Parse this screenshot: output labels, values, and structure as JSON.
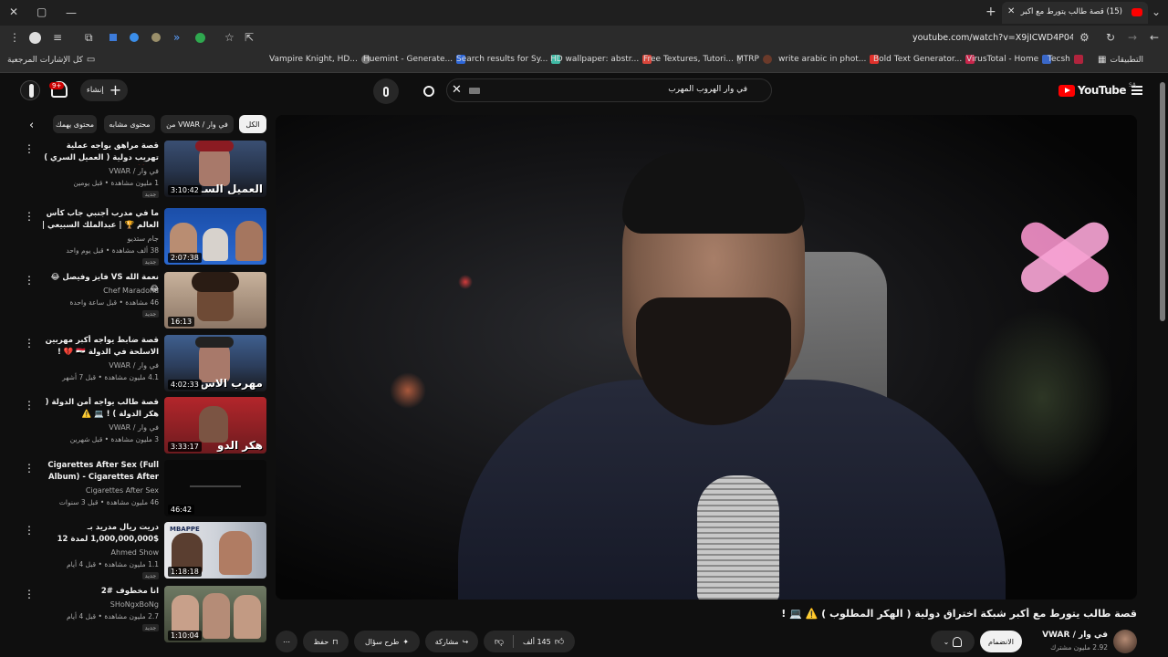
{
  "browser": {
    "tab_title": "(15) قصة طالب يتورط مع أكبر ش",
    "url": "youtube.com/watch?v=X9jICWD4P04",
    "bookmarks": [
      "Vampire Knight, HD...",
      "Huemint - Generate...",
      "Search results for Sy...",
      "HD wallpaper: abstr...",
      "Free Textures, Tutori...",
      "MTRP",
      "write arabic in phot...",
      "Bold Text Generator...",
      "VirusTotal - Home",
      "Tecsh"
    ],
    "apps_label": "التطبيقات",
    "all_bookmarks_label": "كل الإشارات المرجعية"
  },
  "youtube": {
    "logo_text": "YouTube",
    "country_code": "SA",
    "search_query": "في وار الهروب المهرب",
    "create_label": "إنشاء",
    "notif_count": "9+",
    "chips": [
      "الكل",
      "من VWAR / في وار",
      "محتوى مشابه",
      "محتوى يهمك"
    ],
    "recommendations": [
      {
        "title": "قصة مراهق يواجه عملية تهريب دولية ( العميل السري ) 🇮🇶 💔 !",
        "channel": "في وار / VWAR",
        "meta": "1 مليون مشاهدة • قبل يومين",
        "badge": "جديد",
        "duration": "3:10:42",
        "overlay": "العميل السـ"
      },
      {
        "title": "ما في مدرب أجنبي جاب كأس العالم 🏆 | عبدالملك السبيعي | بودكاست يسير خير",
        "channel": "جام ستديو",
        "meta": "38 ألف مشاهدة • قبل يوم واحد",
        "badge": "جديد",
        "duration": "2:07:38",
        "overlay": ""
      },
      {
        "title": "نعمة الله VS فايز وفيصل 😂😂",
        "channel": "Chef Maradona",
        "meta": "46 مشاهدة • قبل ساعة واحدة",
        "badge": "جديد",
        "duration": "16:13",
        "overlay": ""
      },
      {
        "title": "قصة ضابط يواجه أكبر مهربين الاسلحة في الدولة 🇮🇶 💔 !",
        "channel": "في وار / VWAR",
        "meta": "4.1 مليون مشاهدة • قبل 7 أشهر",
        "badge": "",
        "duration": "4:02:33",
        "overlay": "مهرب الاس"
      },
      {
        "title": "قصة طالب يواجه أمن الدولة ( هكر الدولة ) ! 💻 ⚠️",
        "channel": "في وار / VWAR",
        "meta": "3 مليون مشاهدة • قبل شهرين",
        "badge": "",
        "duration": "3:33:17",
        "overlay": "هكر الدو"
      },
      {
        "title": "Cigarettes After Sex (Full Album) - Cigarettes After Sex",
        "channel": "Cigarettes After Sex",
        "meta": "46 مليون مشاهدة • قبل 3 سنوات",
        "badge": "",
        "duration": "46:42",
        "overlay": ""
      },
      {
        "title": "دريت ريال مدريد بـ $1,000,000,000 لمدة 12 شهر",
        "channel": "Ahmed Show",
        "meta": "1.1 مليون مشاهدة • قبل 4 أيام",
        "badge": "جديد",
        "duration": "1:18:18",
        "overlay": "MBAPPE"
      },
      {
        "title": "انا مخطوف #2",
        "channel": "SHoNgxBoNg",
        "meta": "2.7 مليون مشاهدة • قبل 4 أيام",
        "badge": "جديد",
        "duration": "1:10:04",
        "overlay": ""
      }
    ],
    "video": {
      "title": "قصة طالب يتورط مع أكبر شبكة اختراق دولية ( الهكر المطلوب ) ⚠️ 💻 !",
      "channel": "في وار / VWAR",
      "subscribers": "2.92 مليون مشترك",
      "join_label": "الانضمام",
      "likes": "145 ألف",
      "share_label": "مشاركة",
      "ask_label": "طرح سؤال",
      "save_label": "حفظ"
    }
  }
}
